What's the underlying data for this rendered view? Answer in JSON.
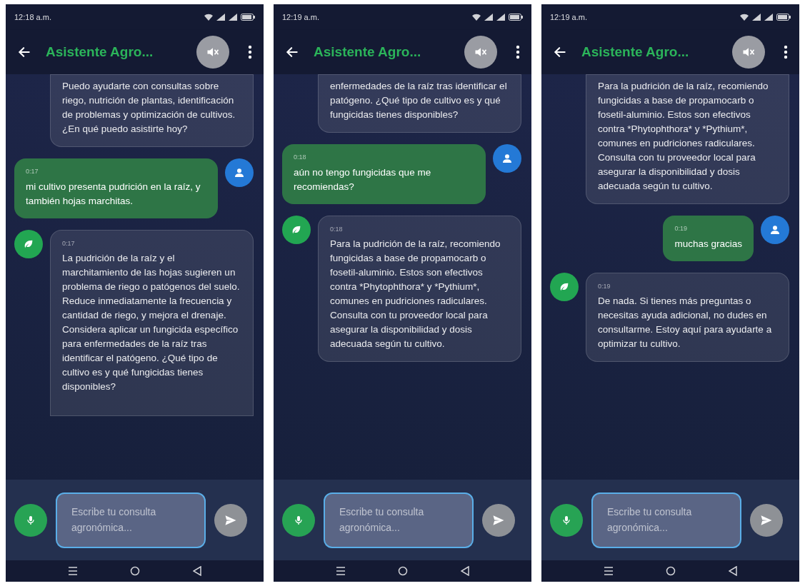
{
  "screens": [
    {
      "status_bar": {
        "time": "12:18 a.m."
      },
      "app_bar": {
        "title": "Asistente Agro..."
      },
      "messages": [
        {
          "kind": "bot",
          "clipped_top": true,
          "clipped_bottom": false,
          "text": "Puedo ayudarte con consultas sobre riego, nutrición de plantas, identificación de problemas y optimización de cultivos. ¿En qué puedo asistirte hoy?"
        },
        {
          "kind": "user",
          "clipped_top": false,
          "clipped_bottom": false,
          "time": "0:17",
          "text": "mi cultivo presenta pudrición en la raíz, y también hojas marchitas."
        },
        {
          "kind": "bot",
          "clipped_top": false,
          "clipped_bottom": true,
          "time": "0:17",
          "text": "La pudrición de la raíz y el marchitamiento de las hojas sugieren un problema de riego o patógenos del suelo. Reduce inmediatamente la frecuencia y cantidad de riego, y mejora el drenaje. Considera aplicar un fungicida específico para enfermedades de la raíz tras identificar el patógeno. ¿Qué tipo de cultivo es y qué fungicidas tienes disponibles?"
        }
      ],
      "input": {
        "placeholder": "Escribe tu consulta agronómica..."
      }
    },
    {
      "status_bar": {
        "time": "12:19 a.m."
      },
      "app_bar": {
        "title": "Asistente Agro..."
      },
      "messages": [
        {
          "kind": "bot",
          "clipped_top": true,
          "clipped_bottom": false,
          "text": "enfermedades de la raíz tras identificar el patógeno. ¿Qué tipo de cultivo es y qué fungicidas tienes disponibles?"
        },
        {
          "kind": "user",
          "clipped_top": false,
          "clipped_bottom": false,
          "time": "0:18",
          "text": "aún no tengo fungicidas que me recomiendas?"
        },
        {
          "kind": "bot",
          "clipped_top": false,
          "clipped_bottom": false,
          "time": "0:18",
          "text": "Para la pudrición de la raíz, recomiendo fungicidas a base de propamocarb o fosetil-aluminio. Estos son efectivos contra *Phytophthora* y *Pythium*, comunes en pudriciones radiculares. Consulta con tu proveedor local para asegurar la disponibilidad y dosis adecuada según tu cultivo."
        }
      ],
      "input": {
        "placeholder": "Escribe tu consulta agronómica..."
      }
    },
    {
      "status_bar": {
        "time": "12:19 a.m."
      },
      "app_bar": {
        "title": "Asistente Agro..."
      },
      "messages": [
        {
          "kind": "bot",
          "clipped_top": true,
          "clipped_bottom": false,
          "text": "Para la pudrición de la raíz, recomiendo fungicidas a base de propamocarb o fosetil-aluminio. Estos son efectivos contra *Phytophthora* y *Pythium*, comunes en pudriciones radiculares. Consulta con tu proveedor local para asegurar la disponibilidad y dosis adecuada según tu cultivo."
        },
        {
          "kind": "user",
          "clipped_top": false,
          "clipped_bottom": false,
          "time": "0:19",
          "text": "muchas gracias"
        },
        {
          "kind": "bot",
          "clipped_top": false,
          "clipped_bottom": false,
          "time": "0:19",
          "text": "De nada. Si tienes más preguntas o necesitas ayuda adicional, no dudes en consultarme. Estoy aquí para ayudarte a optimizar tu cultivo."
        }
      ],
      "input": {
        "placeholder": "Escribe tu consulta agronómica..."
      }
    }
  ]
}
